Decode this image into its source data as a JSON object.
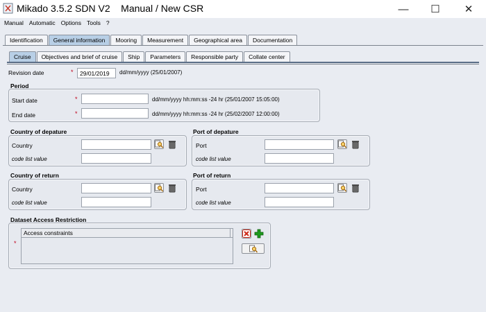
{
  "window": {
    "title": "Mikado 3.5.2 SDN V2    Manual / New CSR",
    "minimize": "—",
    "maximize": "☐",
    "close": "✕"
  },
  "menu": [
    "Manual",
    "Automatic",
    "Options",
    "Tools",
    "?"
  ],
  "main_tabs": [
    "Identification",
    "General information",
    "Mooring",
    "Measurement",
    "Geographical area",
    "Documentation"
  ],
  "main_tab_active": "General information",
  "sub_tabs": [
    "Cruise",
    "Objectives and brief of cruise",
    "Ship",
    "Parameters",
    "Responsible party",
    "Collate center"
  ],
  "sub_tab_active": "Cruise",
  "revision": {
    "label": "Revision date",
    "required": "*",
    "value": "29/01/2019",
    "hint": "dd/mm/yyyy (25/01/2007)"
  },
  "period": {
    "title": "Period",
    "start_label": "Start date",
    "start_value": "",
    "start_hint": "dd/mm/yyyy hh:mm:ss -24 hr (25/01/2007 15:05:00)",
    "end_label": "End date",
    "end_value": "",
    "end_hint": "dd/mm/yyyy hh:mm:ss -24 hr (25/02/2007 12:00:00)",
    "required": "*"
  },
  "country_departure": {
    "title": "Country of depature",
    "field_label": "Country",
    "field_value": "",
    "code_label": "code list value",
    "code_value": ""
  },
  "port_departure": {
    "title": "Port of depature",
    "field_label": "Port",
    "field_value": "",
    "code_label": "code list value",
    "code_value": ""
  },
  "country_return": {
    "title": "Country of return",
    "field_label": "Country",
    "field_value": "",
    "code_label": "code list value",
    "code_value": ""
  },
  "port_return": {
    "title": "Port of return",
    "field_label": "Port",
    "field_value": "",
    "code_label": "code list value",
    "code_value": ""
  },
  "access": {
    "title": "Dataset Access Restriction",
    "column": "Access constraints",
    "required": "*"
  },
  "colors": {
    "background": "#e9ecf2",
    "active_tab": "#b8cfe6",
    "required": "#c0001a",
    "add_green": "#1e9a1e",
    "delete_red": "#cc2a1a"
  },
  "icons": [
    "app-icon",
    "search-icon",
    "trash-icon",
    "delete-icon",
    "add-icon"
  ]
}
